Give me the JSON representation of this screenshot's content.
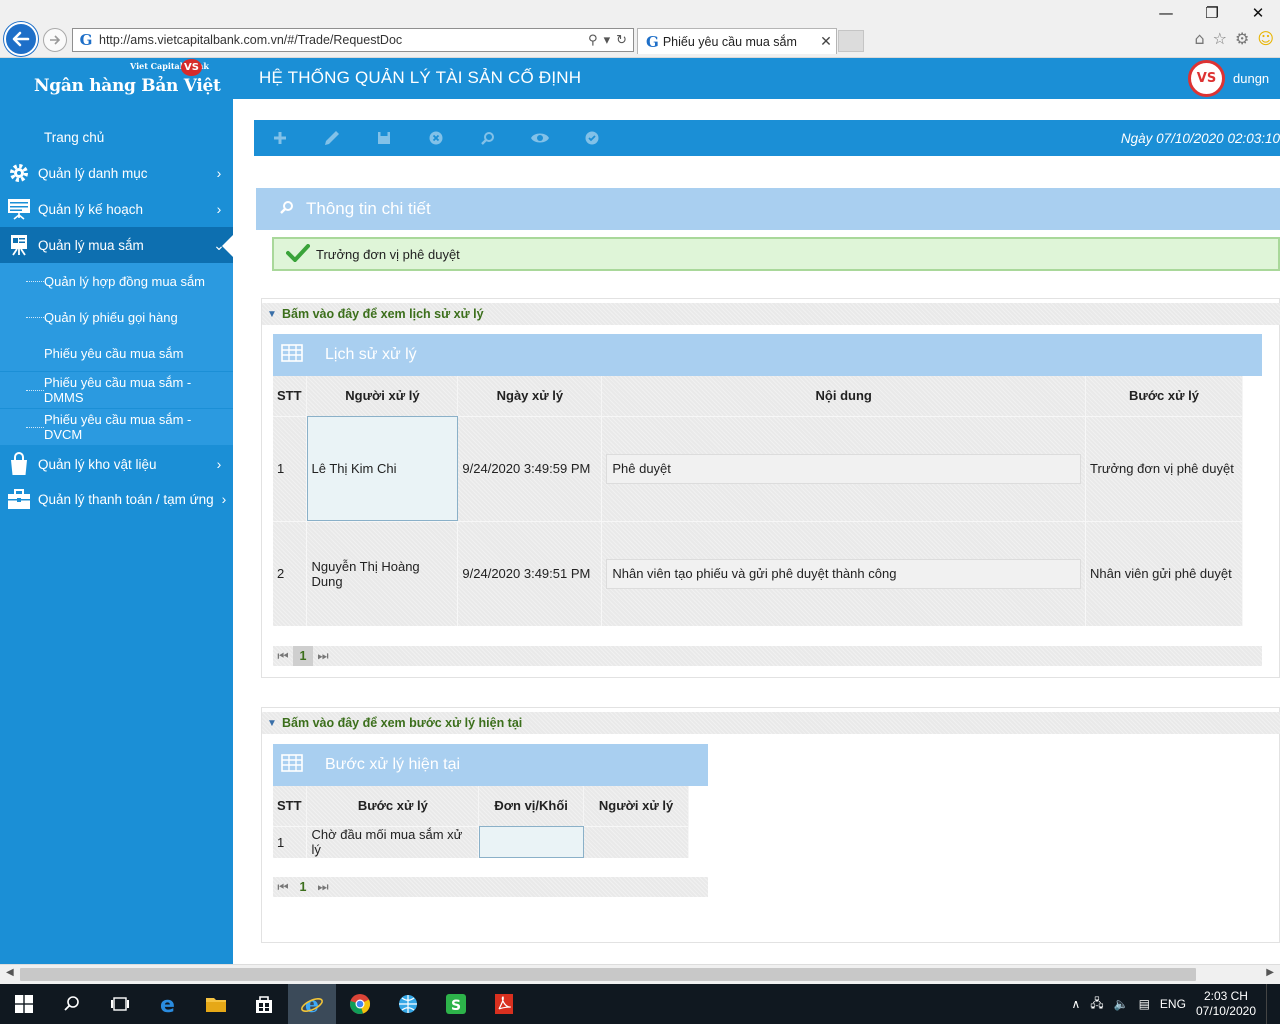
{
  "browser": {
    "url": "http://ams.vietcapitalbank.com.vn/#/Trade/RequestDoc",
    "tab_title": "Phiếu yêu cầu mua sắm",
    "tab_close": "✕",
    "window_controls": [
      "—",
      "❐",
      "✕"
    ]
  },
  "header": {
    "bank_small": "Viet Capital Bank",
    "bank_name": "Ngân hàng Bản Việt",
    "logo_mark": "VS",
    "system_title": "HỆ THỐNG QUẢN LÝ TÀI SẢN CỐ ĐỊNH",
    "user_initials": "VS",
    "user_name": "dungn"
  },
  "sidebar": {
    "items": [
      {
        "label": "Trang chủ"
      },
      {
        "label": "Quản lý danh mục",
        "chevron": "›"
      },
      {
        "label": "Quản lý kế hoạch",
        "chevron": "›"
      },
      {
        "label": "Quản lý mua sắm",
        "chevron": "⌄"
      },
      {
        "label": "Quản lý kho vật liệu",
        "chevron": "›"
      },
      {
        "label": "Quản lý thanh toán / tạm ứng",
        "chevron": "›"
      }
    ],
    "subitems": [
      {
        "label": "Quản lý hợp đồng mua sắm"
      },
      {
        "label": "Quản lý phiếu gọi hàng"
      },
      {
        "label": "Phiếu yêu cầu mua sắm"
      },
      {
        "label": "Phiếu yêu cầu mua sắm - DMMS"
      },
      {
        "label": "Phiếu yêu cầu mua sắm - DVCM"
      }
    ]
  },
  "toolbar": {
    "date_text": "Ngày 07/10/2020   02:03:10"
  },
  "detail": {
    "title": "Thông tin chi tiết",
    "status": "Trưởng đơn vị phê duyệt"
  },
  "history": {
    "toggle_label": "Bấm vào đây để xem lịch sử xử lý",
    "grid_title": "Lịch sử xử lý",
    "columns": [
      "STT",
      "Người xử lý",
      "Ngày xử lý",
      "Nội dung",
      "Bước xử lý"
    ],
    "rows": [
      {
        "stt": "1",
        "user": "Lê Thị Kim Chi",
        "date": "9/24/2020 3:49:59 PM",
        "content": "Phê duyệt",
        "step": "Trưởng đơn vị phê duyệt"
      },
      {
        "stt": "2",
        "user": "Nguyễn Thị Hoàng Dung",
        "date": "9/24/2020 3:49:51 PM",
        "content": "Nhân viên tạo phiếu và gửi phê duyệt thành công",
        "step": "Nhân viên gửi phê duyệt"
      }
    ],
    "pager": {
      "first": "⏮",
      "current": "1",
      "last": "⏭"
    }
  },
  "current": {
    "toggle_label": "Bấm vào đây để xem bước xử lý hiện tại",
    "grid_title": "Bước xử lý hiện tại",
    "columns": [
      "STT",
      "Bước xử lý",
      "Đơn vị/Khối",
      "Người xử lý"
    ],
    "rows": [
      {
        "stt": "1",
        "step": "Chờ đầu mối mua sắm xử lý",
        "unit": "",
        "user": ""
      }
    ],
    "pager": {
      "first": "⏮",
      "current": "1",
      "last": "⏭"
    }
  },
  "taskbar": {
    "language": "ENG",
    "time": "2:03 CH",
    "date": "07/10/2020"
  },
  "colors": {
    "brand_blue": "#1b8fd6",
    "panel_blue": "#a9cff0",
    "success_green": "#dff5d8",
    "label_green": "#3c6f1c"
  }
}
